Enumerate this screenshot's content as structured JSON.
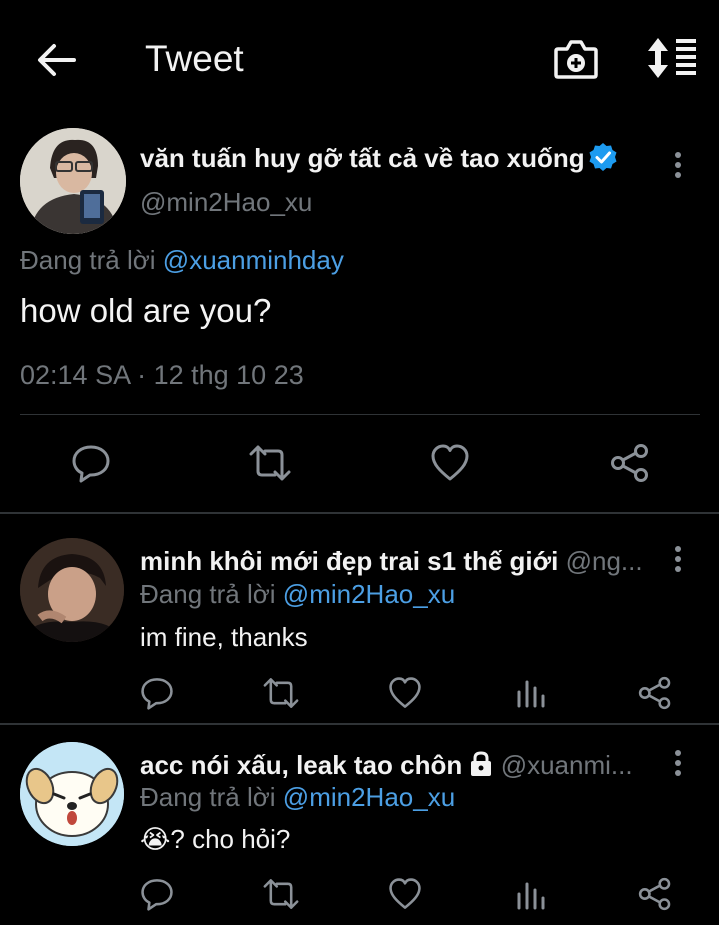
{
  "header": {
    "title": "Tweet",
    "back_icon": "arrow-left-icon",
    "camera_icon": "camera-plus-icon",
    "sort_icon": "sort-list-icon"
  },
  "main_tweet": {
    "display_name": "văn tuấn huy gỡ tất cả về tao xuống",
    "handle": "@min2Hao_xu",
    "replying_prefix": "Đang trả lời",
    "replying_to": "@xuanminhday",
    "text": "how old are you?",
    "timestamp": "02:14 SA · 12 thg 10 23"
  },
  "replies": [
    {
      "display_name": "minh khôi mới đẹp trai s1 thế giới",
      "handle": "@ng...",
      "replying_prefix": "Đang trả lời",
      "replying_to": "@min2Hao_xu",
      "text": "im fine, thanks"
    },
    {
      "display_name": "acc nói xấu, leak tao chôn",
      "handle": "@xuanmi...",
      "replying_prefix": "Đang trả lời",
      "replying_to": "@min2Hao_xu",
      "text": "😭? cho hỏi?"
    }
  ],
  "colors": {
    "background": "#000000",
    "text": "#e7e9ea",
    "muted": "#71767b",
    "link": "#4c9fe4",
    "verified": "#1d9bf0",
    "divider": "#2f3336"
  }
}
